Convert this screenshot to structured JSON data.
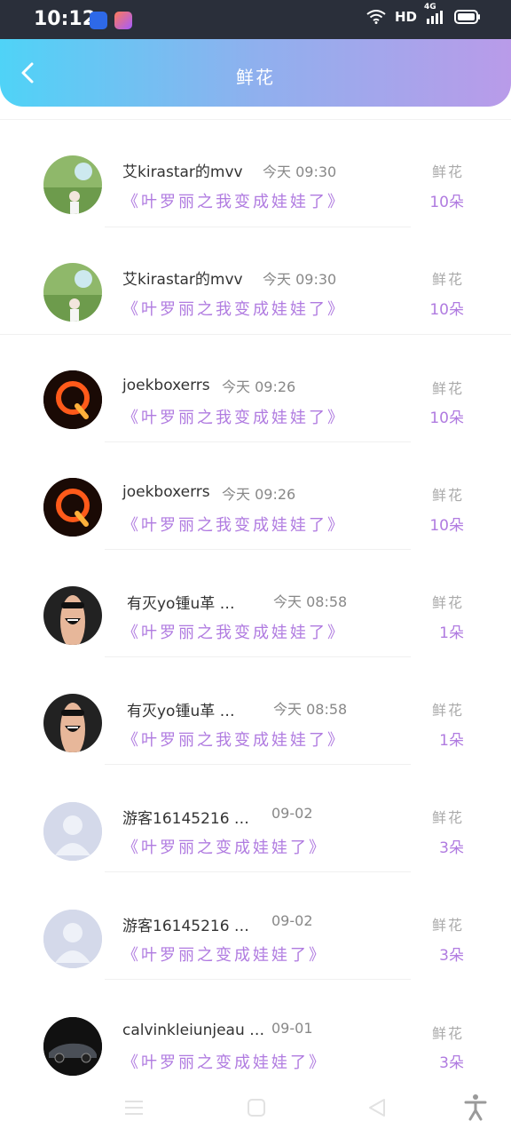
{
  "status": {
    "time": "10:12",
    "network": "HD",
    "signal_label": "4G"
  },
  "header": {
    "title": "鲜花"
  },
  "records": [
    {
      "name": "艾kirastar的mvv",
      "time": "今天 09:30",
      "gift": "《叶罗丽之我变成娃娃了》",
      "type": "鲜花",
      "count": "10朵",
      "avatar": "girl-balloon-photo"
    },
    {
      "name": "艾kirastar的mvv",
      "time": "今天 09:30",
      "gift": "《叶罗丽之我变成娃娃了》",
      "type": "鲜花",
      "count": "10朵",
      "avatar": "girl-balloon-photo"
    },
    {
      "name": "joekboxerrs",
      "time": "今天 09:26",
      "gift": "《叶罗丽之我变成娃娃了》",
      "type": "鲜花",
      "count": "10朵",
      "avatar": "flaming-q-logo"
    },
    {
      "name": "joekboxerrs",
      "time": "今天 09:26",
      "gift": "《叶罗丽之我变成娃娃了》",
      "type": "鲜花",
      "count": "10朵",
      "avatar": "flaming-q-logo"
    },
    {
      "name": "有灭yo锺u革 …",
      "time": "今天 08:58",
      "gift": "《叶罗丽之我变成娃娃了》",
      "type": "鲜花",
      "count": "1朵",
      "avatar": "finger-face-photo"
    },
    {
      "name": "有灭yo锺u革 …",
      "time": "今天 08:58",
      "gift": "《叶罗丽之我变成娃娃了》",
      "type": "鲜花",
      "count": "1朵",
      "avatar": "finger-face-photo"
    },
    {
      "name": "游客16145216 …",
      "time": "09-02",
      "gift": "《叶罗丽之变成娃娃了》",
      "type": "鲜花",
      "count": "3朵",
      "avatar": "default-user"
    },
    {
      "name": "游客16145216 …",
      "time": "09-02",
      "gift": "《叶罗丽之变成娃娃了》",
      "type": "鲜花",
      "count": "3朵",
      "avatar": "default-user"
    },
    {
      "name": "calvinkleiunjeau …",
      "time": "09-01",
      "gift": "《叶罗丽之变成娃娃了》",
      "type": "鲜花",
      "count": "3朵",
      "avatar": "sports-car-photo"
    }
  ],
  "colors": {
    "header_gradient_start": "#4fd3f7",
    "header_gradient_end": "#b99be9",
    "accent_purple": "#b07be0"
  }
}
